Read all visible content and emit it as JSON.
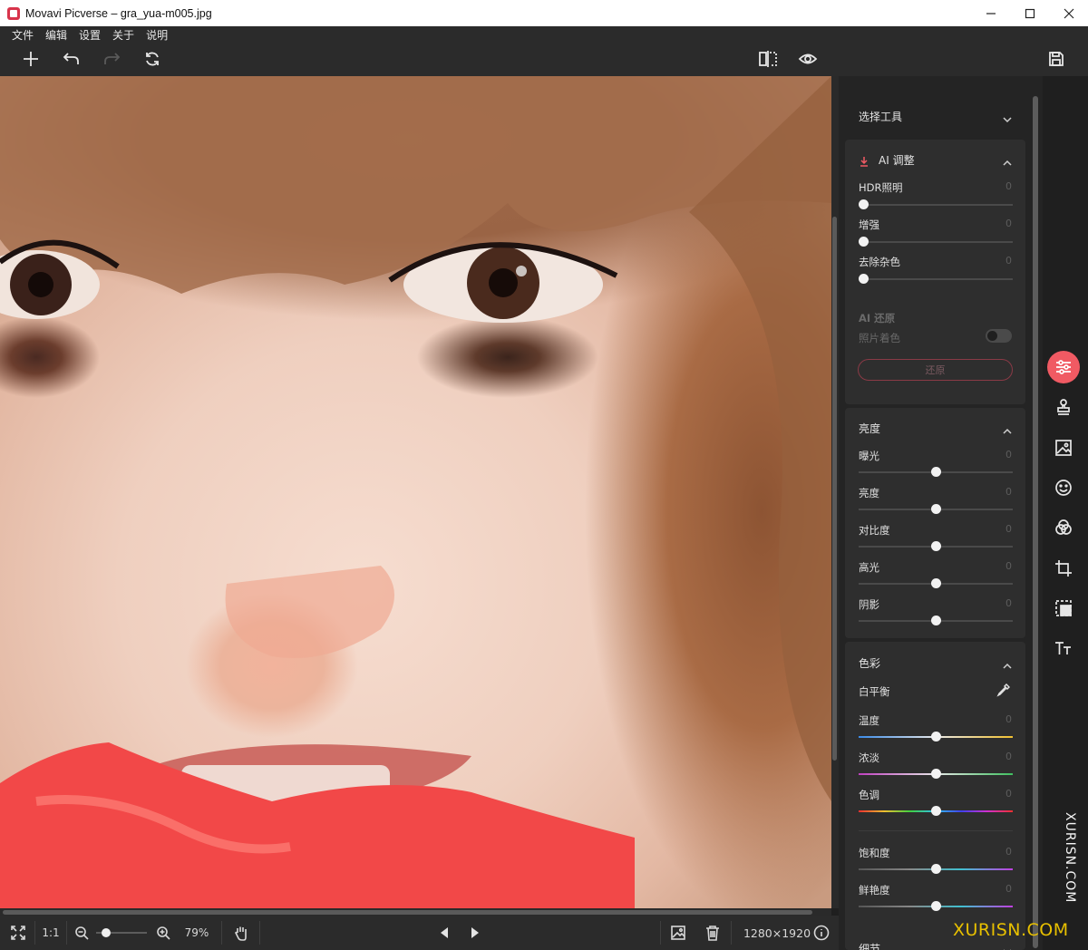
{
  "window": {
    "title": "Movavi Picverse – gra_yua-m005.jpg",
    "minimize_icon": "minimize-icon",
    "maximize_icon": "maximize-icon",
    "close_icon": "close-icon"
  },
  "menu": [
    "文件",
    "编辑",
    "设置",
    "关于",
    "说明"
  ],
  "toolbar": {
    "left": [
      "add-icon",
      "undo-icon",
      "redo-icon",
      "reset-icon"
    ],
    "center": [
      "compare-icon",
      "preview-eye-icon"
    ],
    "right": [
      "save-icon"
    ]
  },
  "bottombar": {
    "fit_icon": "fit-screen-icon",
    "one_to_one": "1:1",
    "zoom_level": "79%",
    "zoom_fraction": 0.2,
    "dimensions": "1280×1920"
  },
  "panel": {
    "select_tool": {
      "title": "选择工具"
    },
    "ai_adjust": {
      "title": "AI 调整",
      "sliders": [
        {
          "label": "HDR照明",
          "value": "0"
        },
        {
          "label": "增强",
          "value": "0"
        },
        {
          "label": "去除杂色",
          "value": "0"
        }
      ],
      "restore_title": "AI 还原",
      "photo_color_label": "照片着色",
      "restore_button": "还原"
    },
    "brightness": {
      "title": "亮度",
      "sliders": [
        {
          "label": "曝光",
          "value": "0"
        },
        {
          "label": "亮度",
          "value": "0"
        },
        {
          "label": "对比度",
          "value": "0"
        },
        {
          "label": "高光",
          "value": "0"
        },
        {
          "label": "阴影",
          "value": "0"
        }
      ]
    },
    "color": {
      "title": "色彩",
      "white_balance": "白平衡",
      "sliders": [
        {
          "label": "温度",
          "value": "0"
        },
        {
          "label": "浓淡",
          "value": "0"
        },
        {
          "label": "色调",
          "value": "0"
        },
        {
          "label": "饱和度",
          "value": "0"
        },
        {
          "label": "鲜艳度",
          "value": "0"
        }
      ]
    },
    "details": {
      "title": "细节"
    }
  },
  "tools": [
    "adjust-icon",
    "stamp-icon",
    "background-icon",
    "face-icon",
    "filters-icon",
    "crop-icon",
    "transform-icon",
    "text-icon"
  ],
  "watermark": {
    "vertical": "XURISN.COM",
    "horizontal": "XURISN.COM"
  },
  "colors": {
    "accent": "#f05a63",
    "panel_bg": "#242424",
    "toolbar_bg": "#2b2b2b"
  }
}
